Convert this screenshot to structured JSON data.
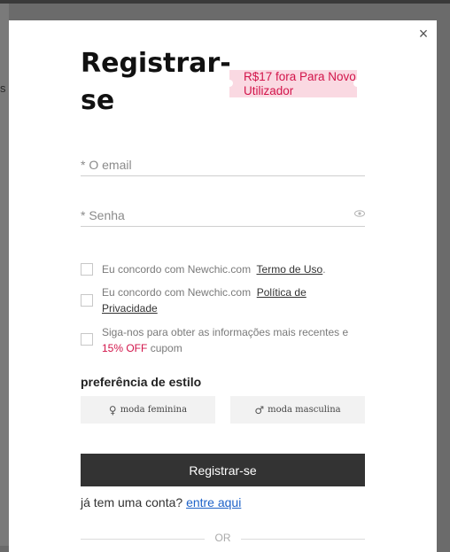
{
  "background": {
    "page_fragment_text": "s"
  },
  "modal": {
    "close_symbol": "×",
    "title": "Registrar-se",
    "promo": "R$17 fora Para Novo Utilizador",
    "email_placeholder": "* O email",
    "password_placeholder": "* Senha",
    "terms": {
      "prefix": "Eu concordo com Newchic.com",
      "link": "Termo de Uso",
      "suffix": "."
    },
    "privacy": {
      "prefix": "Eu concordo com Newchic.com",
      "link": "Política de Privacidade"
    },
    "newsletter": {
      "text": "Siga-nos para obter as informações mais recentes e",
      "highlight": "15% OFF",
      "suffix": "cupom"
    },
    "style_preference": {
      "title": "preferência de estilo",
      "female": {
        "icon": "female-symbol-icon",
        "label": "moda feminina"
      },
      "male": {
        "icon": "male-symbol-icon",
        "label": "moda masculina"
      }
    },
    "submit_label": "Registrar-se",
    "login": {
      "prompt": "já tem uma conta?",
      "link": "entre aqui"
    },
    "or_label": "OR"
  },
  "colors": {
    "accent_red": "#d2144a",
    "promo_bg": "#fad9e2",
    "button_dark": "#333333",
    "link_blue": "#1f63c9"
  }
}
